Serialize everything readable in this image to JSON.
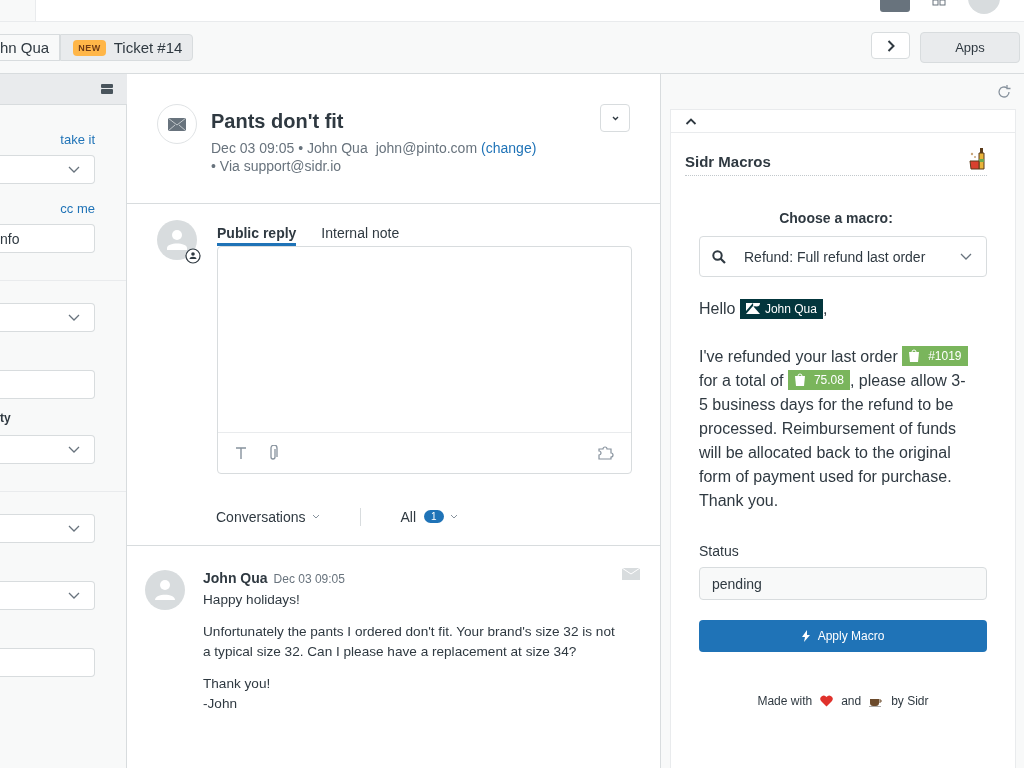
{
  "tabs": [
    {
      "label": "hn Qua",
      "selected": false
    },
    {
      "label": "Ticket #14",
      "badge": "NEW",
      "selected": true
    }
  ],
  "toolbar": {
    "apps_button": "Apps"
  },
  "sidebar": {
    "fields": [
      {
        "kind": "link",
        "text": "take it"
      },
      {
        "kind": "select"
      },
      {
        "kind": "link",
        "text": "cc me"
      },
      {
        "kind": "input",
        "value": "nfo"
      },
      {
        "kind": "divider"
      },
      {
        "kind": "select"
      },
      {
        "kind": "input"
      },
      {
        "kind": "label",
        "text": "ty"
      },
      {
        "kind": "select"
      },
      {
        "kind": "divider"
      },
      {
        "kind": "select"
      },
      {
        "kind": "select"
      },
      {
        "kind": "input"
      }
    ]
  },
  "ticket": {
    "title": "Pants don't fit",
    "meta": "Dec 03 09:05 • John Qua",
    "email": "john@pinto.com",
    "change_link": "(change)",
    "via": "• Via support@sidr.io"
  },
  "composer": {
    "tabs": [
      {
        "label": "Public reply",
        "selected": true
      },
      {
        "label": "Internal note",
        "selected": false
      }
    ]
  },
  "filters": {
    "conversations": "Conversations",
    "all": "All",
    "count": "1"
  },
  "messages": [
    {
      "author": "John Qua",
      "time": "Dec 03 09:05",
      "paragraphs": [
        "Happy holidays!",
        "Unfortunately the pants I ordered don't fit. Your brand's size 32 is not a typical size 32. Can I please have a replacement at size 34?",
        "Thank you!\n-John"
      ]
    }
  ],
  "app": {
    "title": "Sidr Macros",
    "choose_label": "Choose a macro:",
    "macro": "Refund: Full refund last order",
    "greeting": [
      {
        "kind": "text",
        "text": "Hello "
      },
      {
        "kind": "zendesk",
        "text": "John Qua"
      },
      {
        "kind": "text",
        "text": ","
      }
    ],
    "body": [
      {
        "kind": "text",
        "text": "I've refunded your last order "
      },
      {
        "kind": "shopify",
        "text": "#1019"
      },
      {
        "kind": "text",
        "text": " for a total of "
      },
      {
        "kind": "shopify",
        "text": "75.08"
      },
      {
        "kind": "text",
        "text": ", please allow 3-5 business days for the refund to be processed. Reimbursement of funds will be allocated back to the original form of payment used for purchase. Thank you."
      }
    ],
    "status_label": "Status",
    "status_value": "pending",
    "apply_button": "Apply Macro",
    "footer": [
      {
        "kind": "text",
        "text": "Made with"
      },
      {
        "kind": "heart"
      },
      {
        "kind": "text",
        "text": "and"
      },
      {
        "kind": "coffee"
      },
      {
        "kind": "text",
        "text": "by Sidr"
      }
    ]
  }
}
